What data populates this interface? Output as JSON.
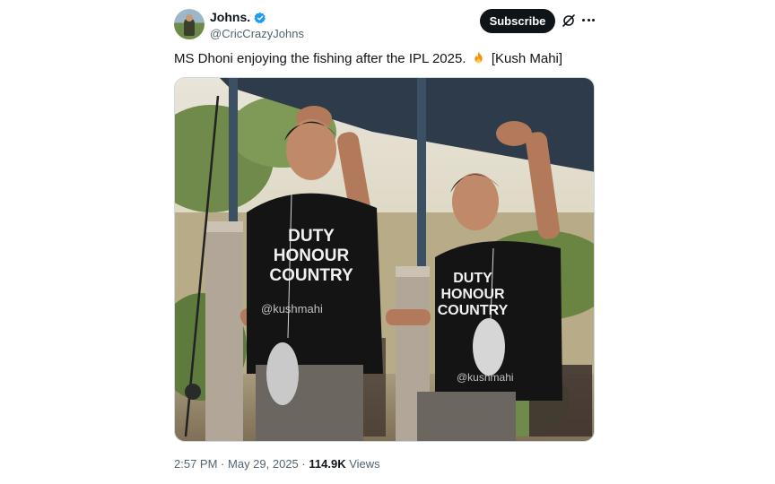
{
  "tweet": {
    "author_name": "Johns.",
    "author_handle": "@CricCrazyJohns",
    "verified": true,
    "subscribe_label": "Subscribe",
    "text_before": "MS Dhoni enjoying the fishing after the IPL 2025.",
    "text_after": "[Kush Mahi]",
    "emoji": "fire",
    "time": "2:57 PM",
    "separator": "·",
    "date": "May 29, 2025",
    "views_count": "114.9K",
    "views_label": "Views"
  },
  "media": {
    "shirt_lines": [
      "DUTY",
      "HONOUR",
      "COUNTRY"
    ],
    "watermark": "@kushmahi"
  },
  "icons": {
    "verified": "verified-badge-icon",
    "grok": "grok-icon",
    "more": "more-options-icon"
  },
  "colors": {
    "text": "#0f1419",
    "secondary": "#536471",
    "verified": "#1d9bf0",
    "button_bg": "#0f1419"
  }
}
